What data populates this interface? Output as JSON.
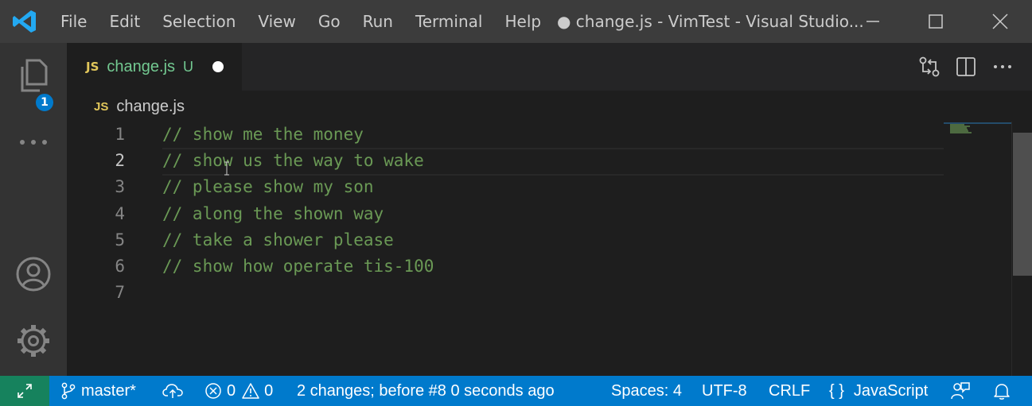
{
  "window": {
    "title": "● change.js - VimTest - Visual Studio...",
    "menu": [
      "File",
      "Edit",
      "Selection",
      "View",
      "Go",
      "Run",
      "Terminal",
      "Help"
    ]
  },
  "activity_bar": {
    "explorer_badge": "1"
  },
  "tab": {
    "icon_label": "JS",
    "name": "change.js",
    "status": "U"
  },
  "breadcrumb": {
    "icon_label": "JS",
    "file": "change.js"
  },
  "editor": {
    "line_numbers": [
      "1",
      "2",
      "3",
      "4",
      "5",
      "6",
      "7"
    ],
    "lines": [
      "// show me the money",
      "// show us the way to wake",
      "// please show my son",
      "// along the shown way",
      "// take a shower please",
      "// show how operate tis-100",
      ""
    ],
    "active_line": 2
  },
  "status_bar": {
    "branch": "master*",
    "errors": "0",
    "warnings": "0",
    "undo_info": "2 changes; before #8  0 seconds ago",
    "indentation": "Spaces: 4",
    "encoding": "UTF-8",
    "eol": "CRLF",
    "language_icon": "{ }",
    "language": "JavaScript"
  },
  "colors": {
    "accent": "#007acc",
    "remote": "#16825d",
    "comment": "#6a9955",
    "untracked": "#73c991",
    "js_icon": "#e2c75b"
  }
}
